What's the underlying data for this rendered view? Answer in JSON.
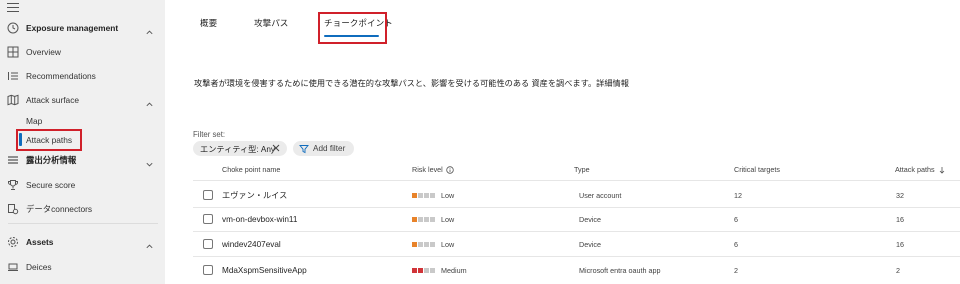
{
  "colors": {
    "accent": "#0f6cbd",
    "highlight": "#d0202a",
    "risk_low": "#e8832a",
    "risk_medium": "#d13438",
    "risk_empty": "#c9c9c9"
  },
  "sidebar": {
    "menu_icon": "hamburger-icon",
    "exposure_management": {
      "label": "Exposure management",
      "icon": "clock-icon"
    },
    "overview": {
      "label": "Overview",
      "icon": "grid-icon"
    },
    "recommendations": {
      "label": "Recommendations",
      "icon": "list-icon"
    },
    "attack_surface": {
      "label": "Attack surface",
      "icon": "map-icon"
    },
    "map": {
      "label": "Map"
    },
    "attack_paths": {
      "label": "Attack paths"
    },
    "exposure_insights": {
      "label": "露出分析情報",
      "icon": "list-icon"
    },
    "secure_score": {
      "label": "Secure score",
      "icon": "trophy-icon"
    },
    "data_connectors": {
      "label": "データconnectors",
      "icon": "connector-icon"
    },
    "assets": {
      "label": "Assets",
      "icon": "gear-icon"
    },
    "devices": {
      "label": "Deices",
      "icon": "laptop-icon"
    }
  },
  "tabs": [
    {
      "label": "概要"
    },
    {
      "label": "攻撃パス"
    },
    {
      "label": "チョークポイント",
      "selected": true
    }
  ],
  "description": "攻撃者が環境を侵害するために使用できる潜在的な攻撃パスと、影響を受ける可能性のある 資産を調べます。詳細情報",
  "filters": {
    "label": "Filter set:",
    "entity_pill": "エンティティ型: Any",
    "add_filter": "Add filter"
  },
  "table": {
    "headers": {
      "name": "Choke point name",
      "risk": "Risk level",
      "type": "Type",
      "critical": "Critical targets",
      "paths": "Attack paths"
    },
    "rows": [
      {
        "name": "エヴァン・ルイス",
        "risk": "Low",
        "risk_filled": 1,
        "type": "User account",
        "critical": "12",
        "paths": "32"
      },
      {
        "name": "vm-on-devbox-win11",
        "risk": "Low",
        "risk_filled": 1,
        "type": "Device",
        "critical": "6",
        "paths": "16"
      },
      {
        "name": "windev2407eval",
        "risk": "Low",
        "risk_filled": 1,
        "type": "Device",
        "critical": "6",
        "paths": "16"
      },
      {
        "name": "MdaXspmSensitiveApp",
        "risk": "Medium",
        "risk_filled": 2,
        "type": "Microsoft entra oauth app",
        "critical": "2",
        "paths": "2"
      }
    ]
  }
}
